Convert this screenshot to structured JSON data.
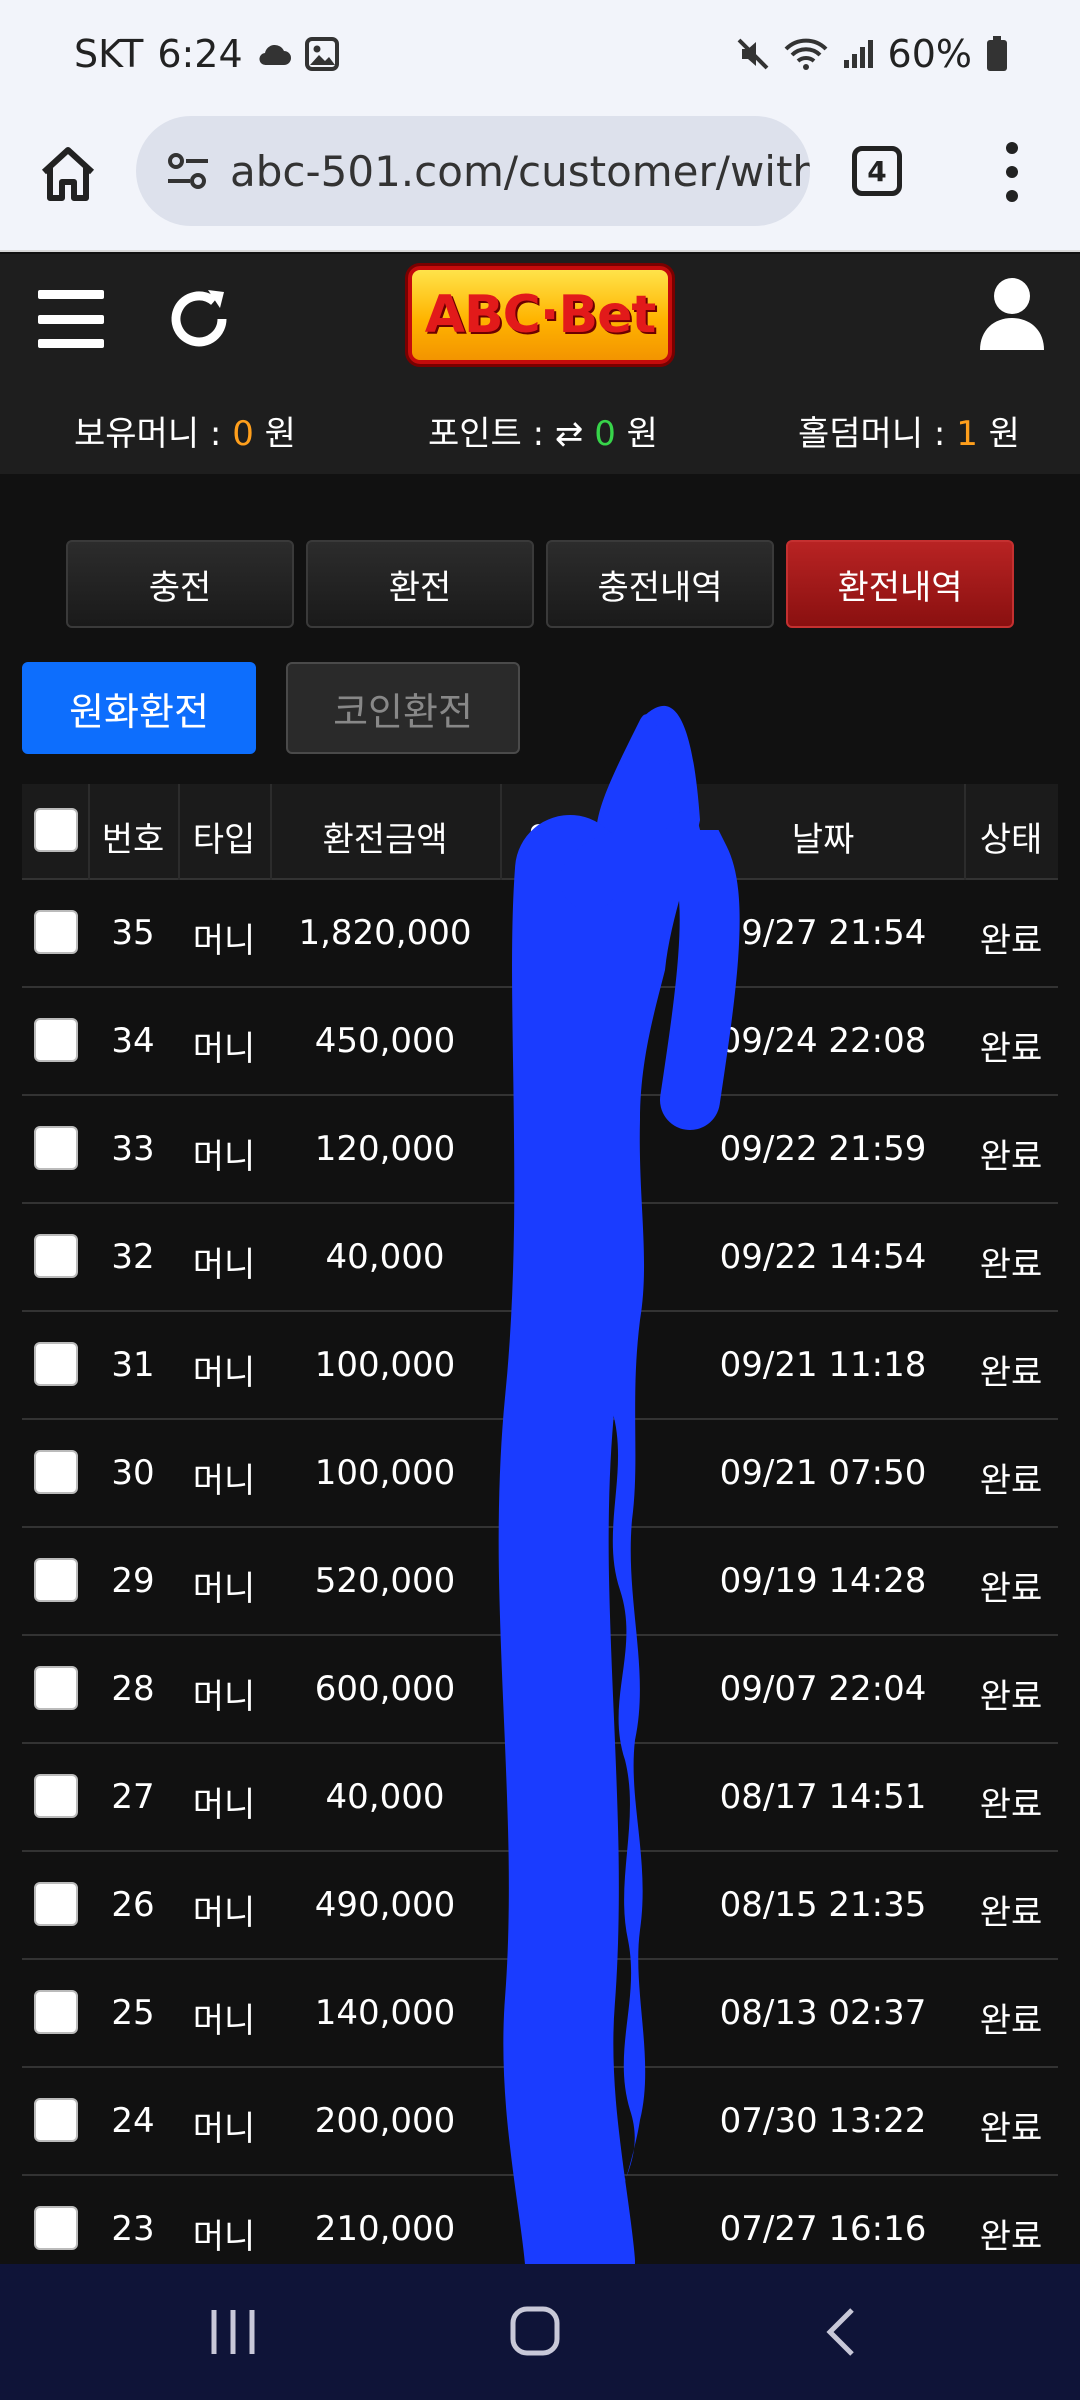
{
  "status_bar": {
    "carrier": "SKT",
    "time": "6:24",
    "battery": "60%"
  },
  "browser": {
    "url": "abc-501.com/customer/with",
    "tab_count": "4"
  },
  "site": {
    "logo": "ABC·Bet",
    "balances": [
      {
        "label": "보유머니 : ",
        "value": "0",
        "unit": " 원",
        "color": "#ff9f1c"
      },
      {
        "label": "포인트 : ",
        "value": "0",
        "unit": " 원",
        "color": "#37d44a"
      },
      {
        "label": "홀덤머니 : ",
        "value": "1",
        "unit": " 원",
        "color": "#ff9f1c"
      }
    ]
  },
  "nav_tabs": [
    "충전",
    "환전",
    "충전내역",
    "환전내역"
  ],
  "active_tab": "환전내역",
  "sub_tabs": {
    "primary": "원화환전",
    "secondary": "코인환전"
  },
  "table": {
    "headers": [
      "번호",
      "타입",
      "환전금액",
      "입금자명",
      "날짜",
      "상태"
    ],
    "rows": [
      {
        "no": "35",
        "type": "머니",
        "amount": "1,820,000",
        "date": "09/27 21:54",
        "status": "완료"
      },
      {
        "no": "34",
        "type": "머니",
        "amount": "450,000",
        "date": "09/24 22:08",
        "status": "완료"
      },
      {
        "no": "33",
        "type": "머니",
        "amount": "120,000",
        "date": "09/22 21:59",
        "status": "완료"
      },
      {
        "no": "32",
        "type": "머니",
        "amount": "40,000",
        "date": "09/22 14:54",
        "status": "완료"
      },
      {
        "no": "31",
        "type": "머니",
        "amount": "100,000",
        "date": "09/21 11:18",
        "status": "완료"
      },
      {
        "no": "30",
        "type": "머니",
        "amount": "100,000",
        "date": "09/21 07:50",
        "status": "완료"
      },
      {
        "no": "29",
        "type": "머니",
        "amount": "520,000",
        "date": "09/19 14:28",
        "status": "완료"
      },
      {
        "no": "28",
        "type": "머니",
        "amount": "600,000",
        "date": "09/07 22:04",
        "status": "완료"
      },
      {
        "no": "27",
        "type": "머니",
        "amount": "40,000",
        "date": "08/17 14:51",
        "status": "완료"
      },
      {
        "no": "26",
        "type": "머니",
        "amount": "490,000",
        "date": "08/15 21:35",
        "status": "완료"
      },
      {
        "no": "25",
        "type": "머니",
        "amount": "140,000",
        "date": "08/13 02:37",
        "status": "완료"
      },
      {
        "no": "24",
        "type": "머니",
        "amount": "200,000",
        "date": "07/30 13:22",
        "status": "완료"
      },
      {
        "no": "23",
        "type": "머니",
        "amount": "210,000",
        "date": "07/27 16:16",
        "status": "완료"
      }
    ]
  }
}
